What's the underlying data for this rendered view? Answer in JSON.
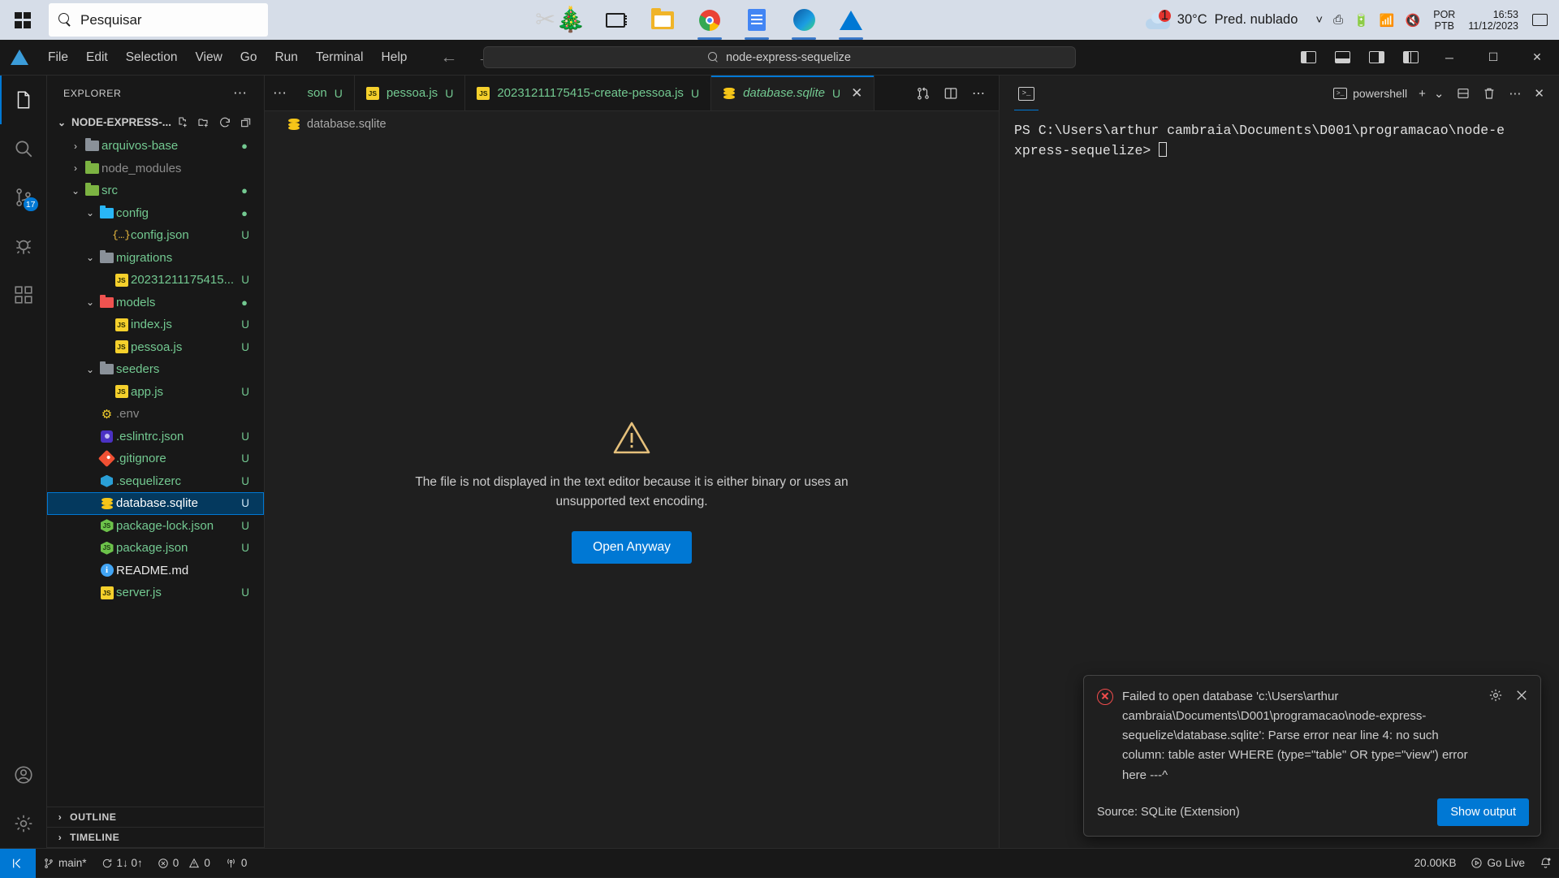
{
  "taskbar": {
    "start_label": "start-button",
    "search_placeholder": "Pesquisar",
    "apps": [
      "snipping-tool",
      "task-view",
      "file-explorer",
      "chrome",
      "google-docs",
      "edge",
      "vscode"
    ],
    "weather": {
      "badge": "1",
      "temperature": "30°C",
      "condition": "Pred. nublado"
    },
    "language": {
      "line1": "POR",
      "line2": "PTB"
    },
    "clock": {
      "time": "16:53",
      "date": "11/12/2023"
    }
  },
  "titlebar": {
    "menus": [
      "File",
      "Edit",
      "Selection",
      "View",
      "Go",
      "Run",
      "Terminal",
      "Help"
    ],
    "command_center": "node-express-sequelize",
    "window_controls": {
      "minimize": "─",
      "maximize": "☐",
      "close": "✕"
    }
  },
  "activitybar": {
    "items": [
      {
        "name": "explorer",
        "badge": ""
      },
      {
        "name": "search",
        "badge": ""
      },
      {
        "name": "source-control",
        "badge": "17"
      },
      {
        "name": "run-and-debug",
        "badge": ""
      },
      {
        "name": "extensions",
        "badge": ""
      }
    ],
    "bottom": [
      "accounts",
      "manage-settings"
    ]
  },
  "sidebar": {
    "title": "EXPLORER",
    "project": "NODE-EXPRESS-...",
    "tree": [
      {
        "name": "arquivos-base",
        "type": "folder",
        "icon": "folder-grey",
        "indent": 1,
        "arrow": "›",
        "status": "",
        "dot": "●",
        "color": "green"
      },
      {
        "name": "node_modules",
        "type": "folder",
        "icon": "folder-green",
        "indent": 1,
        "arrow": "›",
        "status": "",
        "dot": "",
        "color": "grey"
      },
      {
        "name": "src",
        "type": "folder",
        "icon": "folder-src",
        "indent": 1,
        "arrow": "⌄",
        "status": "",
        "dot": "●",
        "color": "green"
      },
      {
        "name": "config",
        "type": "folder",
        "icon": "folder-config",
        "indent": 2,
        "arrow": "⌄",
        "status": "",
        "dot": "●",
        "color": "green"
      },
      {
        "name": "config.json",
        "type": "file",
        "icon": "json-braces",
        "indent": 3,
        "arrow": "",
        "status": "U",
        "dot": "",
        "color": "green"
      },
      {
        "name": "migrations",
        "type": "folder",
        "icon": "folder-grey",
        "indent": 2,
        "arrow": "⌄",
        "status": "",
        "dot": "",
        "color": "green"
      },
      {
        "name": "20231211175415...",
        "type": "file",
        "icon": "js",
        "indent": 3,
        "arrow": "",
        "status": "U",
        "dot": "",
        "color": "green"
      },
      {
        "name": "models",
        "type": "folder",
        "icon": "folder-red",
        "indent": 2,
        "arrow": "⌄",
        "status": "",
        "dot": "●",
        "color": "green"
      },
      {
        "name": "index.js",
        "type": "file",
        "icon": "js",
        "indent": 3,
        "arrow": "",
        "status": "U",
        "dot": "",
        "color": "green"
      },
      {
        "name": "pessoa.js",
        "type": "file",
        "icon": "js",
        "indent": 3,
        "arrow": "",
        "status": "U",
        "dot": "",
        "color": "green"
      },
      {
        "name": "seeders",
        "type": "folder",
        "icon": "folder-grey",
        "indent": 2,
        "arrow": "⌄",
        "status": "",
        "dot": "",
        "color": "green"
      },
      {
        "name": "app.js",
        "type": "file",
        "icon": "js",
        "indent": 3,
        "arrow": "",
        "status": "U",
        "dot": "",
        "color": "green"
      },
      {
        "name": ".env",
        "type": "file",
        "icon": "env",
        "indent": 2,
        "arrow": "",
        "status": "",
        "dot": "",
        "color": "grey"
      },
      {
        "name": ".eslintrc.json",
        "type": "file",
        "icon": "eslint",
        "indent": 2,
        "arrow": "",
        "status": "U",
        "dot": "",
        "color": "green"
      },
      {
        "name": ".gitignore",
        "type": "file",
        "icon": "git",
        "indent": 2,
        "arrow": "",
        "status": "U",
        "dot": "",
        "color": "green"
      },
      {
        "name": ".sequelizerc",
        "type": "file",
        "icon": "sequelize",
        "indent": 2,
        "arrow": "",
        "status": "U",
        "dot": "",
        "color": "green"
      },
      {
        "name": "database.sqlite",
        "type": "file",
        "icon": "database",
        "indent": 2,
        "arrow": "",
        "status": "U",
        "dot": "",
        "color": "white",
        "selected": true
      },
      {
        "name": "package-lock.json",
        "type": "file",
        "icon": "node",
        "indent": 2,
        "arrow": "",
        "status": "U",
        "dot": "",
        "color": "green"
      },
      {
        "name": "package.json",
        "type": "file",
        "icon": "node",
        "indent": 2,
        "arrow": "",
        "status": "U",
        "dot": "",
        "color": "green"
      },
      {
        "name": "README.md",
        "type": "file",
        "icon": "markdown",
        "indent": 2,
        "arrow": "",
        "status": "",
        "dot": "",
        "color": "white"
      },
      {
        "name": "server.js",
        "type": "file",
        "icon": "js",
        "indent": 2,
        "arrow": "",
        "status": "U",
        "dot": "",
        "color": "green"
      }
    ],
    "sections": [
      {
        "label": "OUTLINE",
        "arrow": "›"
      },
      {
        "label": "TIMELINE",
        "arrow": "›"
      }
    ]
  },
  "editor": {
    "overflow_indicator": "⋯",
    "tabs": [
      {
        "label": "son",
        "status": "U",
        "icon": "json",
        "active": false
      },
      {
        "label": "pessoa.js",
        "status": "U",
        "icon": "js",
        "active": false
      },
      {
        "label": "20231211175415-create-pessoa.js",
        "status": "U",
        "icon": "js",
        "active": false
      },
      {
        "label": "database.sqlite",
        "status": "U",
        "icon": "database",
        "active": true,
        "close": "✕"
      }
    ],
    "breadcrumb": "database.sqlite",
    "binary_message": "The file is not displayed in the text editor because it is either binary or uses an unsupported text encoding.",
    "open_anyway_label": "Open Anyway"
  },
  "panel": {
    "shell": "powershell",
    "terminal_line1": "PS C:\\Users\\arthur cambraia\\Documents\\D001\\programacao\\node-e",
    "terminal_line2": "xpress-sequelize>"
  },
  "notification": {
    "message": "Failed to open database 'c:\\Users\\arthur cambraia\\Documents\\D001\\programacao\\node-express-sequelize\\database.sqlite': Parse error near line 4: no such column: table aster WHERE (type=\"table\" OR type=\"view\") error here ---^",
    "source": "Source: SQLite (Extension)",
    "button": "Show output"
  },
  "statusbar": {
    "branch": "main*",
    "sync": "1↓ 0↑",
    "errors": "0",
    "warnings": "0",
    "ports": "0",
    "filesize": "20.00KB",
    "golive": "Go Live"
  },
  "colors": {
    "accent": "#0078d4",
    "git_green": "#73c991",
    "error_red": "#f14c4c",
    "selection_blue": "#04395e"
  }
}
